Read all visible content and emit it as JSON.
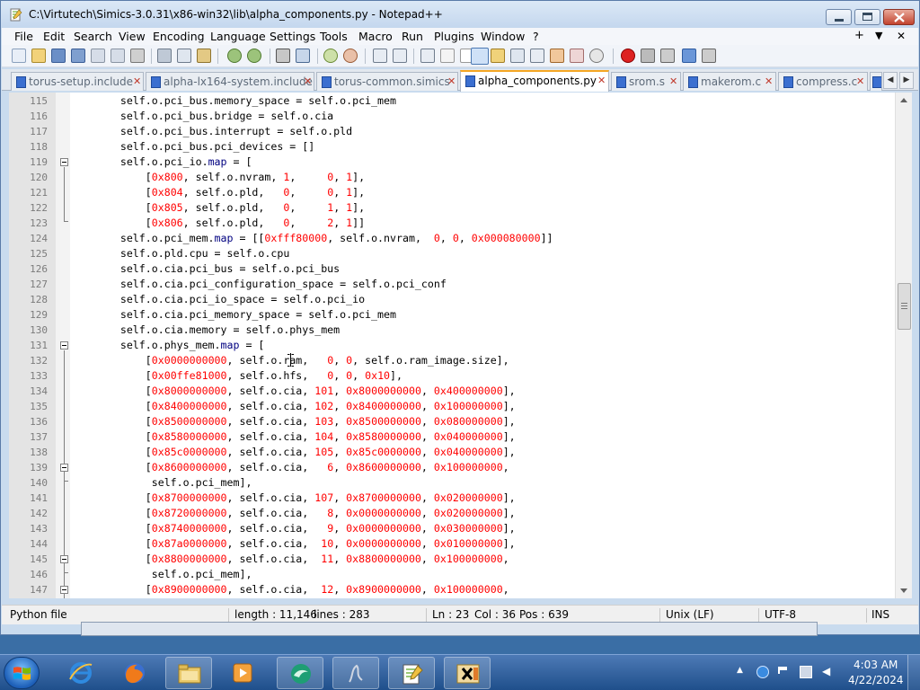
{
  "window": {
    "title": "C:\\Virtutech\\Simics-3.0.31\\x86-win32\\lib\\alpha_components.py - Notepad++"
  },
  "menu": {
    "items": [
      "File",
      "Edit",
      "Search",
      "View",
      "Encoding",
      "Language",
      "Settings",
      "Tools",
      "Macro",
      "Run",
      "Plugins",
      "Window",
      "?"
    ],
    "right": [
      "+",
      "▼",
      "✕"
    ]
  },
  "tabs": [
    {
      "label": "torus-setup.include",
      "active": false
    },
    {
      "label": "alpha-lx164-system.include",
      "active": false
    },
    {
      "label": "torus-common.simics",
      "active": false
    },
    {
      "label": "alpha_components.py",
      "active": true
    },
    {
      "label": "srom.s",
      "active": false
    },
    {
      "label": "makerom.c",
      "active": false
    },
    {
      "label": "compress.c",
      "active": false
    }
  ],
  "editor": {
    "lines": [
      {
        "n": "115",
        "text": "        self.o.pci_bus.memory_space = self.o.pci_mem"
      },
      {
        "n": "116",
        "text": "        self.o.pci_bus.bridge = self.o.cia"
      },
      {
        "n": "117",
        "text": "        self.o.pci_bus.interrupt = self.o.pld"
      },
      {
        "n": "118",
        "text": "        self.o.pci_bus.pci_devices = []"
      },
      {
        "n": "119",
        "text": "        self.o.pci_io.map = ["
      },
      {
        "n": "120",
        "text": "            [0x800, self.o.nvram, 1,     0, 1],"
      },
      {
        "n": "121",
        "text": "            [0x804, self.o.pld,   0,     0, 1],"
      },
      {
        "n": "122",
        "text": "            [0x805, self.o.pld,   0,     1, 1],"
      },
      {
        "n": "123",
        "text": "            [0x806, self.o.pld,   0,     2, 1]]"
      },
      {
        "n": "124",
        "text": "        self.o.pci_mem.map = [[0xfff80000, self.o.nvram,  0, 0, 0x000080000]]"
      },
      {
        "n": "125",
        "text": "        self.o.pld.cpu = self.o.cpu"
      },
      {
        "n": "126",
        "text": "        self.o.cia.pci_bus = self.o.pci_bus"
      },
      {
        "n": "127",
        "text": "        self.o.cia.pci_configuration_space = self.o.pci_conf"
      },
      {
        "n": "128",
        "text": "        self.o.cia.pci_io_space = self.o.pci_io"
      },
      {
        "n": "129",
        "text": "        self.o.cia.pci_memory_space = self.o.pci_mem"
      },
      {
        "n": "130",
        "text": "        self.o.cia.memory = self.o.phys_mem"
      },
      {
        "n": "131",
        "text": "        self.o.phys_mem.map = ["
      },
      {
        "n": "132",
        "text": "            [0x0000000000, self.o.ram,   0, 0, self.o.ram_image.size],"
      },
      {
        "n": "133",
        "text": "            [0x00ffe81000, self.o.hfs,   0, 0, 0x10],"
      },
      {
        "n": "134",
        "text": "            [0x8000000000, self.o.cia, 101, 0x8000000000, 0x400000000],"
      },
      {
        "n": "135",
        "text": "            [0x8400000000, self.o.cia, 102, 0x8400000000, 0x100000000],"
      },
      {
        "n": "136",
        "text": "            [0x8500000000, self.o.cia, 103, 0x8500000000, 0x080000000],"
      },
      {
        "n": "137",
        "text": "            [0x8580000000, self.o.cia, 104, 0x8580000000, 0x040000000],"
      },
      {
        "n": "138",
        "text": "            [0x85c0000000, self.o.cia, 105, 0x85c0000000, 0x040000000],"
      },
      {
        "n": "139",
        "text": "            [0x8600000000, self.o.cia,   6, 0x8600000000, 0x100000000,"
      },
      {
        "n": "140",
        "text": "             self.o.pci_mem],"
      },
      {
        "n": "141",
        "text": "            [0x8700000000, self.o.cia, 107, 0x8700000000, 0x020000000],"
      },
      {
        "n": "142",
        "text": "            [0x8720000000, self.o.cia,   8, 0x0000000000, 0x020000000],"
      },
      {
        "n": "143",
        "text": "            [0x8740000000, self.o.cia,   9, 0x0000000000, 0x030000000],"
      },
      {
        "n": "144",
        "text": "            [0x87a0000000, self.o.cia,  10, 0x0000000000, 0x010000000],"
      },
      {
        "n": "145",
        "text": "            [0x8800000000, self.o.cia,  11, 0x8800000000, 0x100000000,"
      },
      {
        "n": "146",
        "text": "             self.o.pci_mem],"
      },
      {
        "n": "147",
        "text": "            [0x8900000000, self.o.cia,  12, 0x8900000000, 0x100000000,"
      }
    ]
  },
  "statusbar": {
    "filetype": "Python file",
    "length": "length : 11,146",
    "lines": "lines : 283",
    "ln": "Ln : 23",
    "col": "Col : 36",
    "pos": "Pos : 639",
    "eol": "Unix (LF)",
    "encoding": "UTF-8",
    "mode": "INS"
  },
  "taskbar": {
    "apps": [
      "internet-explorer",
      "firefox",
      "file-explorer",
      "media-player",
      "app-green",
      "app-wave",
      "notepad-plus-plus",
      "hxd-hex-editor"
    ],
    "time": "4:03 AM",
    "date": "4/22/2024"
  },
  "colors": {
    "keyword": "#000080",
    "number": "#ff0000",
    "active_tab_accent": "#f5a623"
  }
}
